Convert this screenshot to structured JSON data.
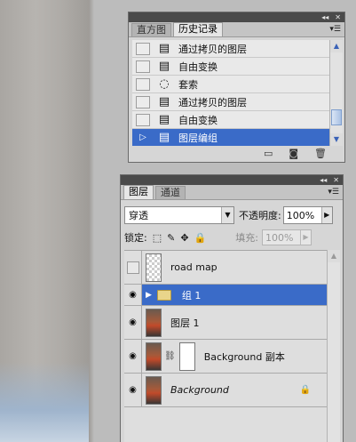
{
  "history_panel": {
    "tabs": [
      {
        "label": "直方图",
        "active": false
      },
      {
        "label": "历史记录",
        "active": true
      }
    ],
    "items": [
      {
        "label": "通过拷贝的图层",
        "icon": "history-step-icon"
      },
      {
        "label": "自由变换",
        "icon": "history-step-icon"
      },
      {
        "label": "套索",
        "icon": "lasso-icon"
      },
      {
        "label": "通过拷贝的图层",
        "icon": "history-step-icon"
      },
      {
        "label": "自由变换",
        "icon": "history-step-icon"
      },
      {
        "label": "图层编组",
        "icon": "history-step-icon",
        "active": true
      }
    ],
    "footer_buttons": [
      "new-document-from-state-icon",
      "camera-snapshot-icon",
      "trash-icon"
    ]
  },
  "layers_panel": {
    "tabs": [
      {
        "label": "图层",
        "active": true
      },
      {
        "label": "通道",
        "active": false
      }
    ],
    "blend_mode": "穿透",
    "opacity_label": "不透明度:",
    "opacity_value": "100%",
    "lock_label": "锁定:",
    "fill_label": "填充:",
    "fill_value": "100%",
    "layers": [
      {
        "name": "road map",
        "visible": false,
        "thumbnail": "transparent"
      },
      {
        "name": "组 1",
        "visible": true,
        "type": "group",
        "selected": true
      },
      {
        "name": "图层 1",
        "visible": true,
        "thumbnail": "photo"
      },
      {
        "name": "Background 副本",
        "visible": true,
        "thumbnail": "photo",
        "mask": true
      },
      {
        "name": "Background",
        "visible": true,
        "thumbnail": "photo",
        "locked": true
      }
    ]
  },
  "colors": {
    "selection": "#3a6bc8",
    "panel_bg": "#d6d6d6",
    "titlebar": "#4a4a4a"
  }
}
